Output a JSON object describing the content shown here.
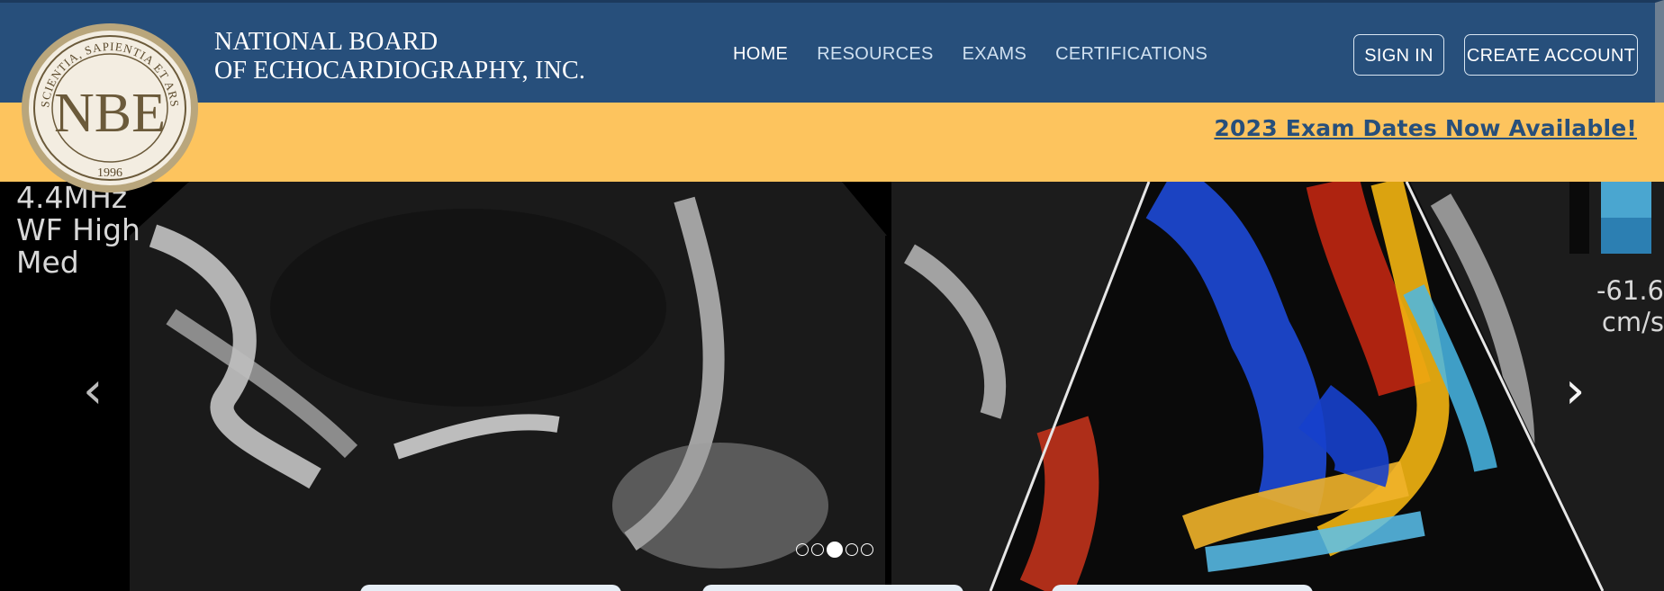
{
  "brand": {
    "line1": "NATIONAL BOARD",
    "line2": "OF ECHOCARDIOGRAPHY, INC.",
    "logo_letters": "NBE",
    "logo_motto": "SCIENTIA, SAPIENTIA ET ARS",
    "logo_year": "1996"
  },
  "nav": {
    "items": [
      {
        "label": "HOME"
      },
      {
        "label": "RESOURCES"
      },
      {
        "label": "EXAMS"
      },
      {
        "label": "CERTIFICATIONS"
      }
    ],
    "sign_in": "SIGN IN",
    "create_account": "CREATE ACCOUNT"
  },
  "banner": {
    "text": "2023 Exam Dates Now Available!"
  },
  "hero": {
    "overlay_lines": [
      "4.4MHz",
      "WF High",
      "Med"
    ],
    "velocity_lines": [
      "-61.6",
      "cm/s"
    ],
    "prev_label": "‹",
    "next_label": "›",
    "slide_count": 5,
    "active_slide": 3
  },
  "colors": {
    "nav_bg": "#274f7b",
    "banner_bg": "#fdc45e",
    "banner_text": "#274f7b"
  }
}
